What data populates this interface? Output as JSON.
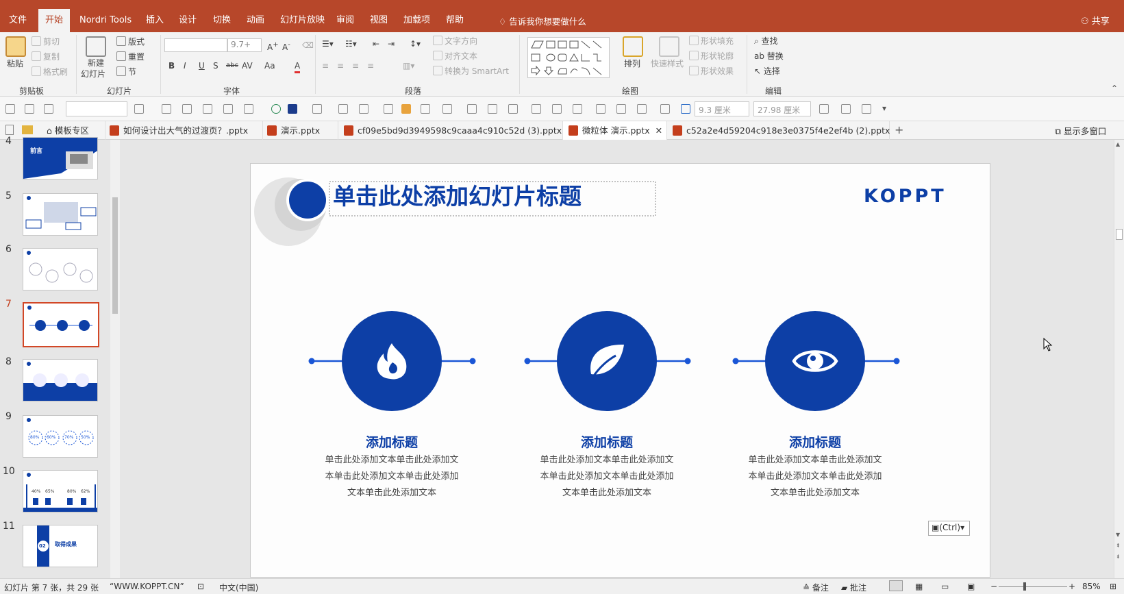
{
  "ribbon_tabs": [
    "文件",
    "开始",
    "Nordri Tools",
    "插入",
    "设计",
    "切换",
    "动画",
    "幻灯片放映",
    "审阅",
    "视图",
    "加载项",
    "帮助"
  ],
  "active_tab": "开始",
  "tell_me": "告诉我你想要做什么",
  "share": "共享",
  "clipboard": {
    "paste": "粘贴",
    "cut": "剪切",
    "copy": "复制",
    "format_painter": "格式刷",
    "group": "剪贴板"
  },
  "slides_group": {
    "new_slide_line1": "新建",
    "new_slide_line2": "幻灯片",
    "layout": "版式",
    "reset": "重置",
    "section": "节",
    "group": "幻灯片"
  },
  "font_group": {
    "font_size": "9.7+",
    "bold": "B",
    "italic": "I",
    "underline": "U",
    "shadow": "S",
    "strike": "abc",
    "spacing": "AV",
    "case": "Aa",
    "color": "A",
    "group": "字体"
  },
  "paragraph_group": {
    "text_direction": "文字方向",
    "align_text": "对齐文本",
    "smartart": "转换为 SmartArt",
    "group": "段落"
  },
  "drawing_group": {
    "arrange": "排列",
    "quick_styles": "快速样式",
    "shape_fill": "形状填充",
    "shape_outline": "形状轮廓",
    "shape_effects": "形状效果",
    "group": "绘图"
  },
  "editing_group": {
    "find": "查找",
    "replace": "替换",
    "select": "选择",
    "group": "编辑"
  },
  "toolbar2": {
    "width": "9.3 厘米",
    "height": "27.98 厘米"
  },
  "doc_tabs": [
    {
      "label": "模板专区"
    },
    {
      "label": "如何设计出大气的过渡页？.pptx"
    },
    {
      "label": "演示.pptx"
    },
    {
      "label": "cf09e5bd9d3949598c9caaa4c910c52d (3).pptx"
    },
    {
      "label": "微粒体 演示.pptx"
    },
    {
      "label": "c52a2e4d59204c918e3e0375f4e2ef4b (2).pptx"
    }
  ],
  "multi_window": "显示多窗口",
  "thumbnails": [
    {
      "num": "4",
      "title": "前言"
    },
    {
      "num": "5"
    },
    {
      "num": "6"
    },
    {
      "num": "7",
      "selected": true
    },
    {
      "num": "8"
    },
    {
      "num": "9",
      "pcts": [
        "80%",
        "60%",
        "70%",
        "50%"
      ]
    },
    {
      "num": "10",
      "pcts": [
        "40%",
        "65%",
        "80%",
        "62%"
      ]
    },
    {
      "num": "11",
      "badge": "02",
      "title": "取得成果"
    }
  ],
  "slide": {
    "title": "单击此处添加幻灯片标题",
    "logo": "KOPPT",
    "columns": [
      {
        "icon": "fire-icon",
        "title": "添加标题",
        "text": [
          "单击此处添加文本单击此处添加文",
          "本单击此处添加文本单击此处添加",
          "文本单击此处添加文本"
        ]
      },
      {
        "icon": "leaf-icon",
        "title": "添加标题",
        "text": [
          "单击此处添加文本单击此处添加文",
          "本单击此处添加文本单击此处添加",
          "文本单击此处添加文本"
        ]
      },
      {
        "icon": "eye-icon",
        "title": "添加标题",
        "text": [
          "单击此处添加文本单击此处添加文",
          "本单击此处添加文本单击此处添加",
          "文本单击此处添加文本"
        ]
      }
    ],
    "paste_options": "(Ctrl)"
  },
  "status": {
    "slide_info": "幻灯片 第 7 张，共 29 张",
    "theme": "“WWW.KOPPT.CN”",
    "language": "中文(中国)",
    "notes": "备注",
    "comments": "批注",
    "zoom": "85%"
  },
  "colors": {
    "accent": "#b7472a",
    "slide_blue": "#0d3fa6",
    "line_blue": "#1a56d6"
  }
}
